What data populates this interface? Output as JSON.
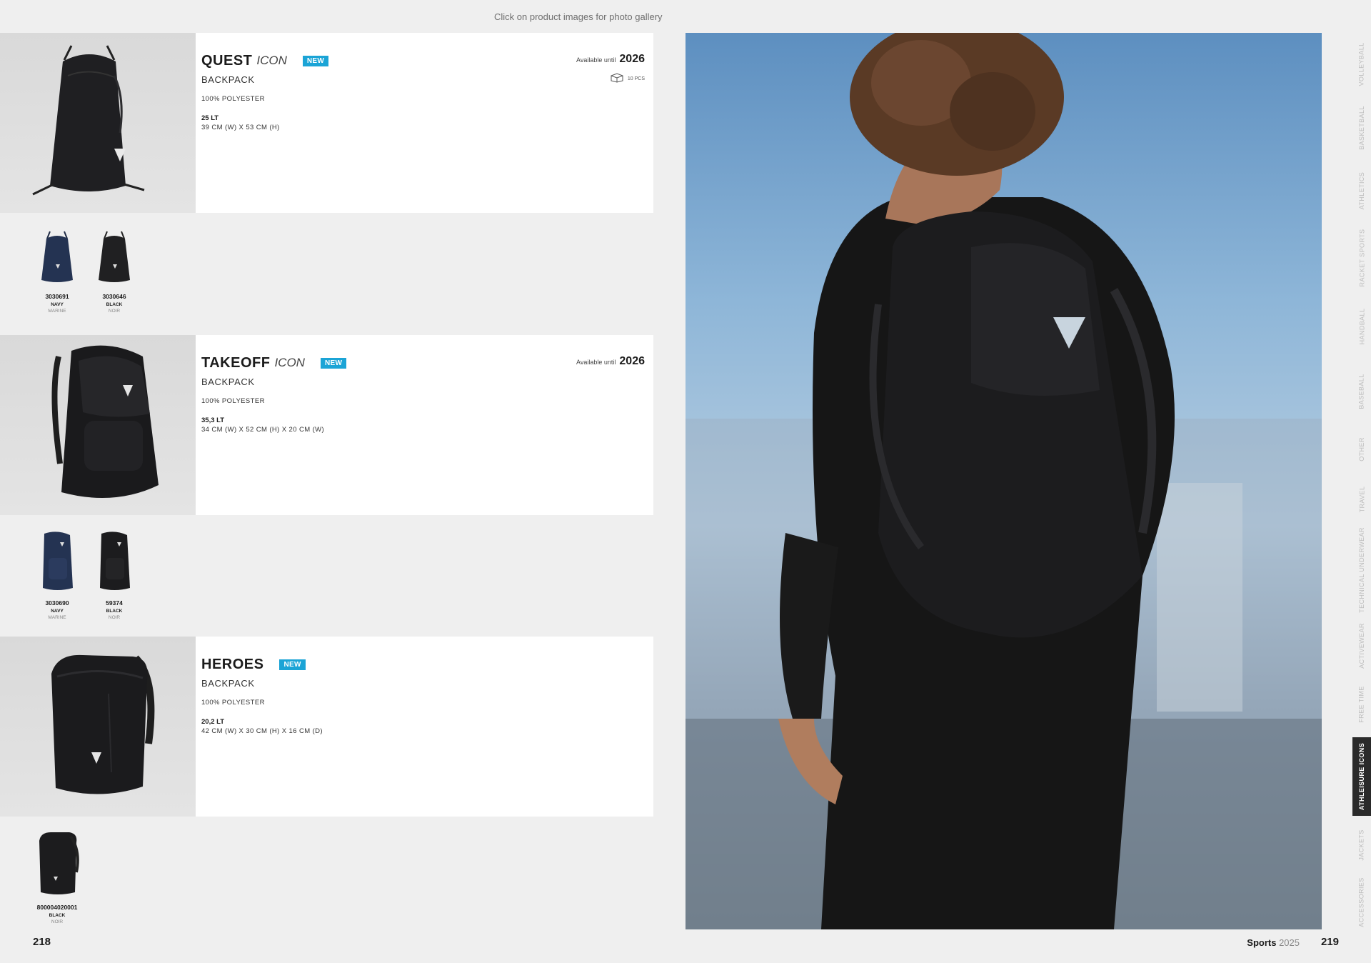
{
  "header": {
    "hint": "Click on product images for photo gallery"
  },
  "products": [
    {
      "name": "QUEST",
      "line": "ICON",
      "badge": "NEW",
      "category": "BACKPACK",
      "material": "100% POLYESTER",
      "volume": "25 LT",
      "dimensions": "39 CM (W) X 53 CM (H)",
      "available_label": "Available until",
      "available_year": "2026",
      "pack": "10 PCS",
      "variants": [
        {
          "code": "3030691",
          "color": "NAVY",
          "color_fr": "MARINE"
        },
        {
          "code": "3030646",
          "color": "BLACK",
          "color_fr": "NOIR"
        }
      ]
    },
    {
      "name": "TAKEOFF",
      "line": "ICON",
      "badge": "NEW",
      "category": "BACKPACK",
      "material": "100% POLYESTER",
      "volume": "35,3 LT",
      "dimensions": "34 CM (W) X 52 CM (H) X 20 CM (W)",
      "available_label": "Available until",
      "available_year": "2026",
      "variants": [
        {
          "code": "3030690",
          "color": "NAVY",
          "color_fr": "MARINE"
        },
        {
          "code": "59374",
          "color": "BLACK",
          "color_fr": "NOIR"
        }
      ]
    },
    {
      "name": "HEROES",
      "badge": "NEW",
      "category": "BACKPACK",
      "material": "100% POLYESTER",
      "volume": "20,2 LT",
      "dimensions": "42 CM (W) X 30 CM (H) X 16 CM (D)",
      "variants": [
        {
          "code": "800004020001",
          "color": "BLACK",
          "color_fr": "NOIR"
        }
      ]
    }
  ],
  "footer": {
    "left_page": "218",
    "right_page": "219",
    "brand": "Sports",
    "year": "2025"
  },
  "side_nav": [
    "VOLLEYBALL",
    "BASKETBALL",
    "ATHLETICS",
    "RACKET SPORTS",
    "HANDBALL",
    "BASEBALL",
    "OTHER",
    "TRAVEL",
    "TECHNICAL UNDERWEAR",
    "ACTIVEWEAR",
    "FREE TIME",
    "ATHLEISURE ICONS",
    "JACKETS",
    "ACCESSORIES"
  ],
  "side_nav_active": "ATHLEISURE ICONS",
  "colors": {
    "badge": "#1ba4d6",
    "navy": "#1f2b45",
    "black": "#1b1b1b",
    "active_tab": "#2a2a2a"
  }
}
